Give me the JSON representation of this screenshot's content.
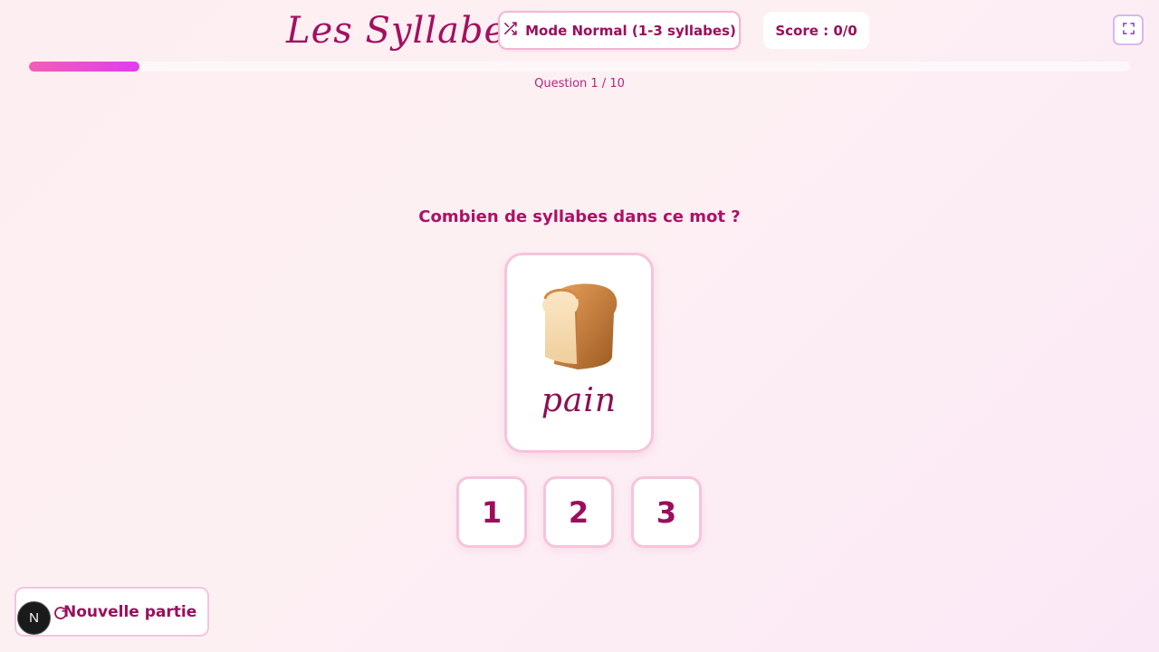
{
  "header": {
    "title": "Les Syllabes",
    "mode_label": "Mode Normal (1-3 syllabes)",
    "mode_icon": "shuffle-icon",
    "score_text": "Score : 0/0",
    "fullscreen_icon": "fullscreen-icon"
  },
  "progress": {
    "fraction": 0.1,
    "counter_text": "Question 1 / 10"
  },
  "question": {
    "prompt": "Combien de syllabes dans ce mot ?",
    "word": "pain",
    "image_icon": "bread-icon"
  },
  "answers": [
    "1",
    "2",
    "3"
  ],
  "footer": {
    "new_game_label": "Nouvelle partie",
    "new_game_icon": "restart-icon",
    "badge_letter": "N"
  },
  "colors": {
    "accent": "#9b0e5c",
    "progress_start": "#f25fb6",
    "progress_end": "#e23cf0",
    "card_border": "#f6c4dc"
  }
}
